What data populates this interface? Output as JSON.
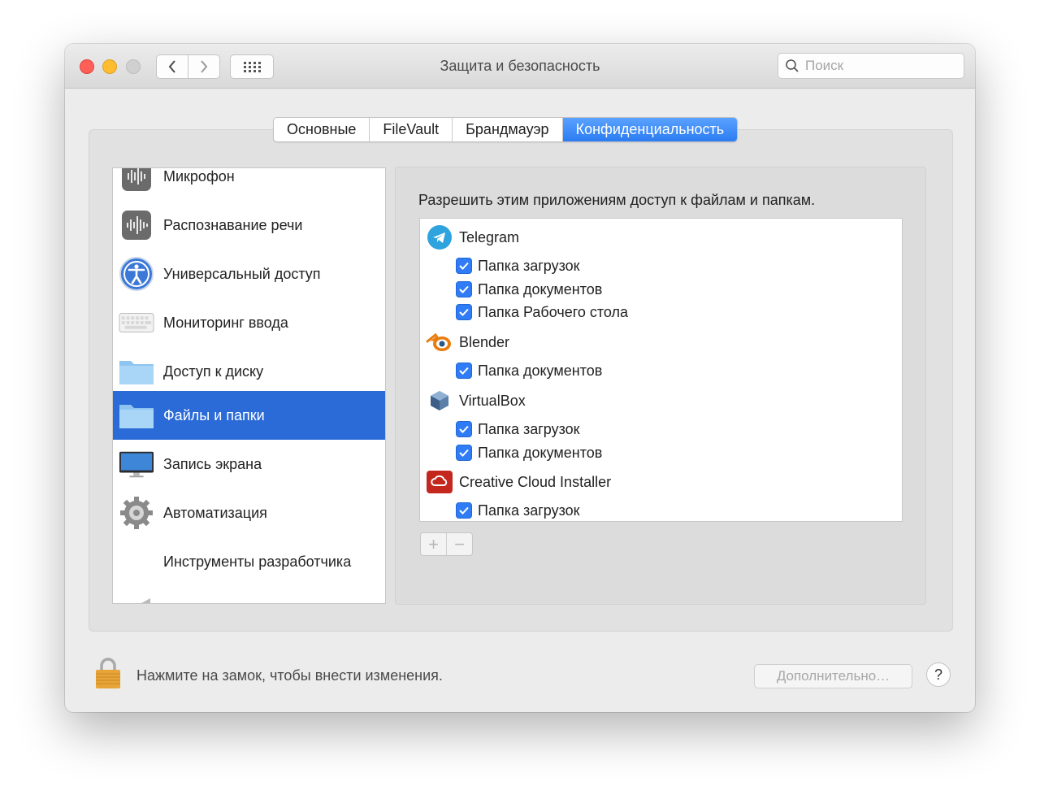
{
  "window": {
    "title": "Защита и безопасность",
    "search_placeholder": "Поиск"
  },
  "tabs": [
    {
      "label": "Основные",
      "active": false
    },
    {
      "label": "FileVault",
      "active": false
    },
    {
      "label": "Брандмауэр",
      "active": false
    },
    {
      "label": "Конфиденциальность",
      "active": true
    }
  ],
  "sidebar": {
    "items": [
      {
        "label": "Микрофон",
        "icon": "microphone-icon"
      },
      {
        "label": "Распознавание речи",
        "icon": "speech-recognition-icon"
      },
      {
        "label": "Универсальный доступ",
        "icon": "accessibility-icon"
      },
      {
        "label": "Мониторинг ввода",
        "icon": "keyboard-icon"
      },
      {
        "label": "Доступ к диску",
        "icon": "folder-icon"
      },
      {
        "label": "Файлы и папки",
        "icon": "folder-icon",
        "selected": true
      },
      {
        "label": "Запись экрана",
        "icon": "display-icon"
      },
      {
        "label": "Автоматизация",
        "icon": "gear-icon"
      },
      {
        "label": "Инструменты разработчика",
        "icon": ""
      }
    ]
  },
  "panel": {
    "heading": "Разрешить этим приложениям доступ к файлам и папкам.",
    "apps": [
      {
        "name": "Telegram",
        "icon": "telegram-icon",
        "permissions": [
          "Папка загрузок",
          "Папка документов",
          "Папка Рабочего стола"
        ]
      },
      {
        "name": "Blender",
        "icon": "blender-icon",
        "permissions": [
          "Папка документов"
        ]
      },
      {
        "name": "VirtualBox",
        "icon": "virtualbox-icon",
        "permissions": [
          "Папка загрузок",
          "Папка документов"
        ]
      },
      {
        "name": "Creative Cloud Installer",
        "icon": "creative-cloud-icon",
        "permissions": [
          "Папка загрузок"
        ]
      }
    ],
    "add_label": "+",
    "remove_label": "−"
  },
  "footer": {
    "lock_text": "Нажмите на замок, чтобы внести изменения.",
    "advanced_label": "Дополнительно…",
    "help_label": "?"
  },
  "colors": {
    "accent": "#2a6bd8",
    "tab_active": "#2b7cf2",
    "checkbox": "#2f7cf6"
  }
}
